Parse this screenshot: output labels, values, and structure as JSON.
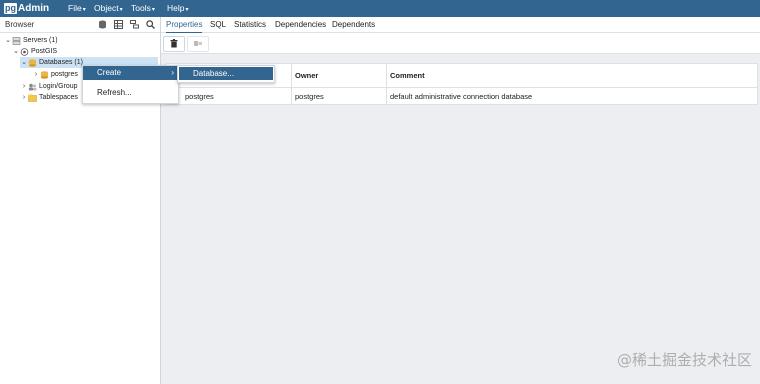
{
  "app": {
    "logo_pg": "pg",
    "logo_admin": "Admin"
  },
  "menubar": [
    {
      "label": "File"
    },
    {
      "label": "Object"
    },
    {
      "label": "Tools"
    },
    {
      "label": "Help"
    }
  ],
  "browser": {
    "title": "Browser",
    "tree": [
      {
        "label": "Servers (1)",
        "chevron": "⌄",
        "icon": "server-group-icon"
      },
      {
        "label": "PostGIS",
        "chevron": "⌄",
        "icon": "server-icon"
      },
      {
        "label": "Databases (1)",
        "chevron": "⌄",
        "icon": "databases-icon",
        "selected": true
      },
      {
        "label": "postgres",
        "chevron": "›",
        "icon": "database-icon"
      },
      {
        "label": "Login/Group",
        "chevron": "›",
        "icon": "login-role-icon"
      },
      {
        "label": "Tablespaces",
        "chevron": "›",
        "icon": "tablespace-icon"
      }
    ]
  },
  "context_menu": {
    "create_label": "Create",
    "create_arrow": "›",
    "refresh_label": "Refresh...",
    "submenu_database": "Database..."
  },
  "tabs": [
    {
      "label": "Properties",
      "active": true
    },
    {
      "label": "SQL"
    },
    {
      "label": "Statistics"
    },
    {
      "label": "Dependencies"
    },
    {
      "label": "Dependents"
    }
  ],
  "table": {
    "columns": [
      "",
      "Owner",
      "Comment"
    ],
    "rows": [
      [
        "postgres",
        "postgres",
        "default administrative connection database"
      ]
    ]
  },
  "watermark": "@稀土掘金技术社区",
  "colors": {
    "accent": "#326690",
    "selected": "#cde3f5",
    "panel_bg": "#eceef1"
  }
}
